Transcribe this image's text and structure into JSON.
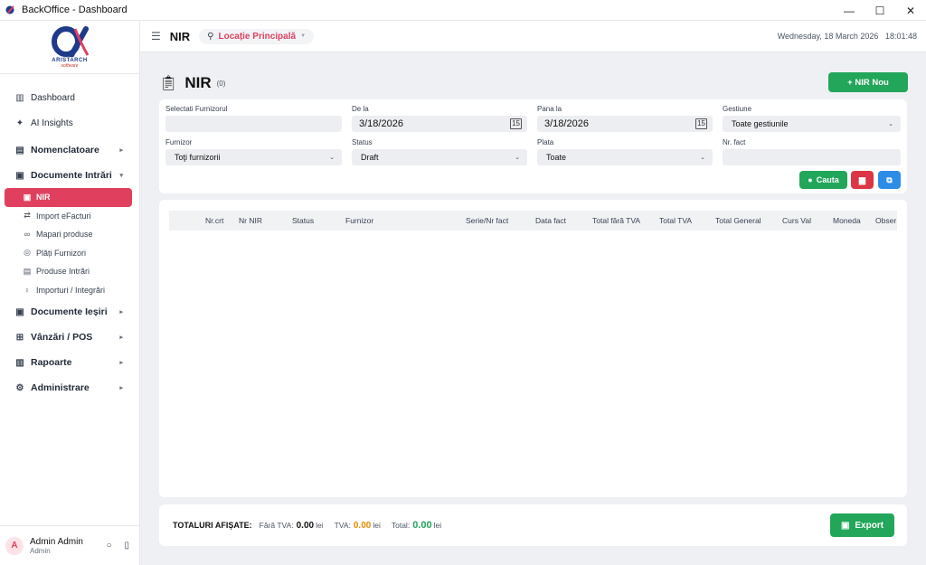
{
  "window": {
    "title": "BackOffice - Dashboard",
    "minimize": "—",
    "maximize": "☐",
    "close": "✕"
  },
  "brand": {
    "name": "ARISTARCH",
    "sub": "software"
  },
  "sidebar": {
    "items": [
      {
        "label": "Dashboard",
        "icon": "bar-chart-icon"
      },
      {
        "label": "AI Insights",
        "icon": "sparkle-icon"
      },
      {
        "label": "Nomenclatoare",
        "icon": "book-icon"
      },
      {
        "label": "Documente Intrări",
        "icon": "clipboard-icon"
      },
      {
        "label": "Documente Ieșiri",
        "icon": "clipboard-icon"
      },
      {
        "label": "Vânzări / POS",
        "icon": "cart-icon"
      },
      {
        "label": "Rapoarte",
        "icon": "report-icon"
      },
      {
        "label": "Administrare",
        "icon": "gear-icon"
      }
    ],
    "subitems": [
      {
        "label": "NIR",
        "icon": "box-icon"
      },
      {
        "label": "Import eFacturi",
        "icon": "import-icon"
      },
      {
        "label": "Mapari produse",
        "icon": "link-icon"
      },
      {
        "label": "Plăți Furnizori",
        "icon": "money-icon"
      },
      {
        "label": "Produse Intrări",
        "icon": "list-icon"
      },
      {
        "label": "Importuri / Integrări",
        "icon": "plug-icon"
      }
    ]
  },
  "user": {
    "initial": "A",
    "name": "Admin Admin",
    "role": "Admin"
  },
  "topbar": {
    "page": "NIR",
    "location": "Locație Principală",
    "date": "Wednesday, 18 March 2026",
    "time": "18:01:48"
  },
  "header": {
    "title": "NIR",
    "count": "(0)",
    "new_button": "+ NIR Nou"
  },
  "filters": {
    "supplier_search": {
      "label": "Selectati Furnizorul",
      "value": ""
    },
    "from": {
      "label": "De la",
      "value": "3/18/2026"
    },
    "to": {
      "label": "Pana la",
      "value": "3/18/2026"
    },
    "gestiune": {
      "label": "Gestiune",
      "value": "Toate gestiunile"
    },
    "furnizor": {
      "label": "Furnizor",
      "value": "Toţi furnizorii"
    },
    "status": {
      "label": "Status",
      "value": "Draft"
    },
    "plata": {
      "label": "Plata",
      "value": "Toate"
    },
    "nr_fact": {
      "label": "Nr. fact",
      "value": ""
    },
    "search_button": "Cauta",
    "calendar_day": "15"
  },
  "table": {
    "columns": [
      "Nr.crt",
      "Nr NIR",
      "Status",
      "Furnizor",
      "Serie/Nr fact",
      "Data fact",
      "Total fără TVA",
      "Total TVA",
      "Total General",
      "Curs Val",
      "Moneda",
      "Obser"
    ],
    "rows": []
  },
  "totals": {
    "title": "TOTALURI AFIȘATE:",
    "no_vat_label": "Fără TVA:",
    "no_vat": "0.00",
    "vat_label": "TVA:",
    "vat": "0.00",
    "total_label": "Total:",
    "total": "0.00",
    "unit": "lei",
    "export_button": "Export"
  },
  "colors": {
    "accent": "#e0405e",
    "green": "#22a65a",
    "red": "#dc3545",
    "blue": "#2d8ce6",
    "vat_orange": "#e68a00"
  }
}
